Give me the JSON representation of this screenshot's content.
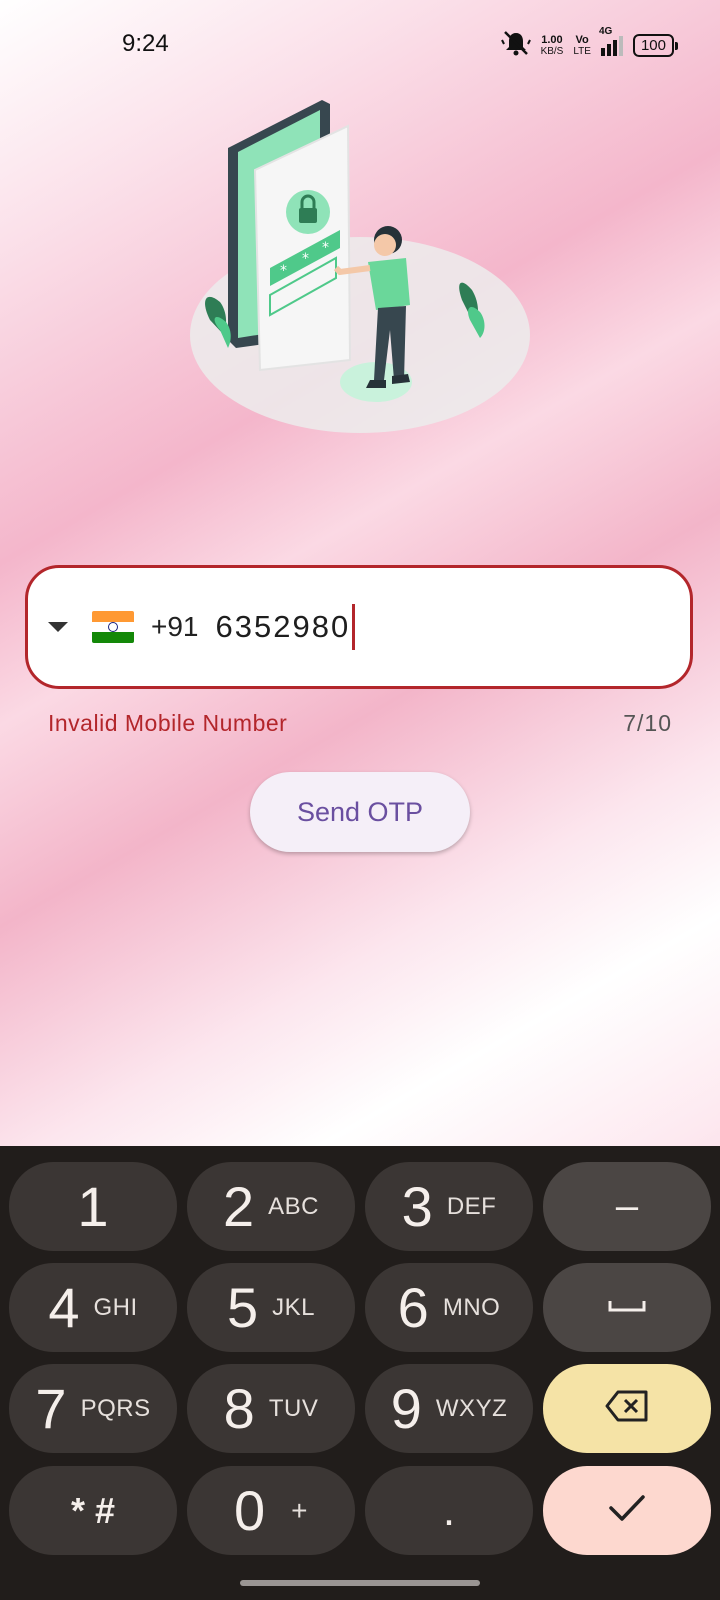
{
  "status_bar": {
    "time": "9:24",
    "speed_value": "1.00",
    "speed_unit": "KB/S",
    "volte_top": "Vo",
    "volte_bottom": "LTE",
    "network": "4G",
    "battery": "100"
  },
  "phone_input": {
    "country_flag": "india-flag",
    "dial_code": "+91",
    "value": "6352980",
    "error": "Invalid Mobile Number",
    "counter": "7/10"
  },
  "actions": {
    "send_otp": "Send OTP"
  },
  "keyboard": {
    "rows": [
      [
        {
          "digit": "1",
          "letters": ""
        },
        {
          "digit": "2",
          "letters": "ABC"
        },
        {
          "digit": "3",
          "letters": "DEF"
        },
        {
          "digit": "–",
          "letters": ""
        }
      ],
      [
        {
          "digit": "4",
          "letters": "GHI"
        },
        {
          "digit": "5",
          "letters": "JKL"
        },
        {
          "digit": "6",
          "letters": "MNO"
        },
        {
          "digit": "␣",
          "letters": ""
        }
      ],
      [
        {
          "digit": "7",
          "letters": "PQRS"
        },
        {
          "digit": "8",
          "letters": "TUV"
        },
        {
          "digit": "9",
          "letters": "WXYZ"
        },
        {
          "digit": "",
          "letters": ""
        }
      ],
      [
        {
          "digit": "* #",
          "letters": ""
        },
        {
          "digit": "0",
          "letters": "+"
        },
        {
          "digit": ".",
          "letters": ""
        },
        {
          "digit": "",
          "letters": ""
        }
      ]
    ]
  },
  "colors": {
    "error": "#b3262b",
    "accent": "#6a4fa0",
    "keyboard_bg": "#211d1b",
    "key_bg": "#3b3634",
    "backspace_bg": "#f5e3a6",
    "done_bg": "#fdd8cf"
  }
}
